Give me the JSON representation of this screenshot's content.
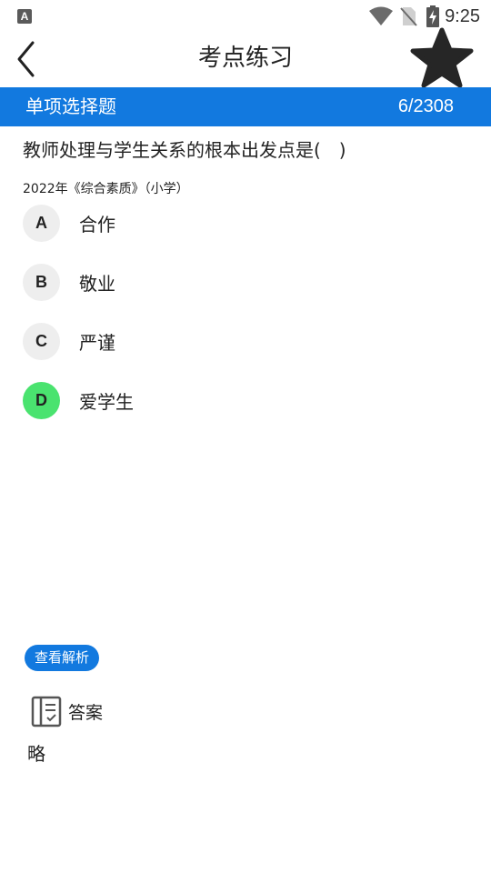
{
  "status_bar": {
    "app_icon_letter": "A",
    "time": "9:25",
    "icons": [
      "wifi-icon",
      "no-sim-icon",
      "battery-charging-icon"
    ]
  },
  "header": {
    "title": "考点练习",
    "back_icon": "chevron-left-icon",
    "favorite_icon": "star-icon"
  },
  "question_bar": {
    "type": "单项选择题",
    "progress": "6/2308"
  },
  "question": {
    "text": "教师处理与学生关系的根本出发点是(　)",
    "source": "2022年《综合素质》（小学）",
    "options": [
      {
        "letter": "A",
        "text": "合作",
        "correct": false
      },
      {
        "letter": "B",
        "text": "敬业",
        "correct": false
      },
      {
        "letter": "C",
        "text": "严谨",
        "correct": false
      },
      {
        "letter": "D",
        "text": "爱学生",
        "correct": true
      }
    ]
  },
  "analysis": {
    "button_label": "查看解析",
    "answer_icon": "notebook-icon",
    "answer_label": "答案",
    "answer_content": "略"
  },
  "colors": {
    "accent": "#1279df",
    "correct": "#4ae36f",
    "option_badge": "#eeeeee"
  }
}
